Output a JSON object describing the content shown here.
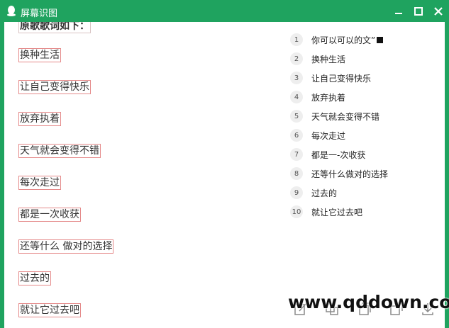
{
  "window": {
    "title": "屏幕识图"
  },
  "image_pane": {
    "heading": "原歌歌词如下：",
    "lines": [
      "换种生活",
      "让自己变得快乐",
      "放弃执着",
      "天气就会变得不错",
      "每次走过",
      "都是一次收获",
      "还等什么 做对的选择",
      "过去的",
      "就让它过去吧"
    ]
  },
  "results": [
    {
      "num": "1",
      "text": "你可以可以的文”"
    },
    {
      "num": "2",
      "text": "换种生活"
    },
    {
      "num": "3",
      "text": "让自己变得快乐"
    },
    {
      "num": "4",
      "text": "放弃执着"
    },
    {
      "num": "5",
      "text": "天气就会变得不错"
    },
    {
      "num": "6",
      "text": "每次走过"
    },
    {
      "num": "7",
      "text": "都是一-次收获"
    },
    {
      "num": "8",
      "text": "还等什么做对的选择"
    },
    {
      "num": "9",
      "text": "过去的"
    },
    {
      "num": "10",
      "text": "就让它过去吧"
    }
  ],
  "watermark": "www.qddown.com",
  "colors": {
    "titlebar": "#1fa35f",
    "outline": "#e58a8a"
  },
  "icons": [
    "qq-icon",
    "minimize-icon",
    "maximize-icon",
    "close-icon",
    "edit-icon",
    "translate-icon",
    "copy-icon",
    "duplicate-icon",
    "download-icon"
  ]
}
